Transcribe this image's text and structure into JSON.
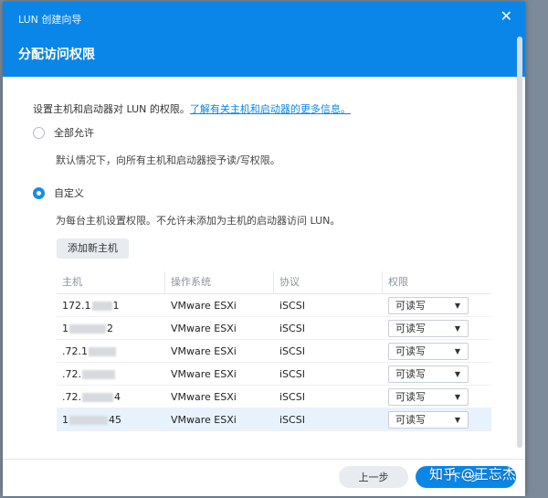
{
  "window": {
    "wizard_title": "LUN 创建向导",
    "close_glyph": "✕"
  },
  "step": {
    "title": "分配访问权限"
  },
  "description": {
    "text": "设置主机和启动器对 LUN 的权限。",
    "link": "了解有关主机和启动器的更多信息。"
  },
  "options": [
    {
      "label": "全部允许",
      "checked": false,
      "hint": "默认情况下，向所有主机和启动器授予读/写权限。"
    },
    {
      "label": "自定义",
      "checked": true,
      "hint": "为每台主机设置权限。不允许未添加为主机的启动器访问 LUN。"
    }
  ],
  "add_button": "添加新主机",
  "table": {
    "columns": [
      "主机",
      "操作系统",
      "协议",
      "权限"
    ],
    "rows": [
      {
        "host_prefix": "172.1",
        "host_suffix": "1",
        "os": "VMware ESXi",
        "protocol": "iSCSI",
        "permission": "可读写"
      },
      {
        "host_prefix": "1",
        "host_suffix": "2",
        "os": "VMware ESXi",
        "protocol": "iSCSI",
        "permission": "可读写"
      },
      {
        "host_prefix": ".72.1",
        "host_suffix": "",
        "os": "VMware ESXi",
        "protocol": "iSCSI",
        "permission": "可读写"
      },
      {
        "host_prefix": ".72.",
        "host_suffix": "",
        "os": "VMware ESXi",
        "protocol": "iSCSI",
        "permission": "可读写"
      },
      {
        "host_prefix": ".72.",
        "host_suffix": "4",
        "os": "VMware ESXi",
        "protocol": "iSCSI",
        "permission": "可读写"
      },
      {
        "host_prefix": "1",
        "host_suffix": "45",
        "os": "VMware ESXi",
        "protocol": "iSCSI",
        "permission": "可读写",
        "selected": true
      }
    ]
  },
  "footer": {
    "prev": "上一步",
    "next": "下一步"
  },
  "watermark": "知乎 @王忘杰",
  "colors": {
    "accent": "#0a86e8",
    "selected_row": "#e7f2fd"
  }
}
